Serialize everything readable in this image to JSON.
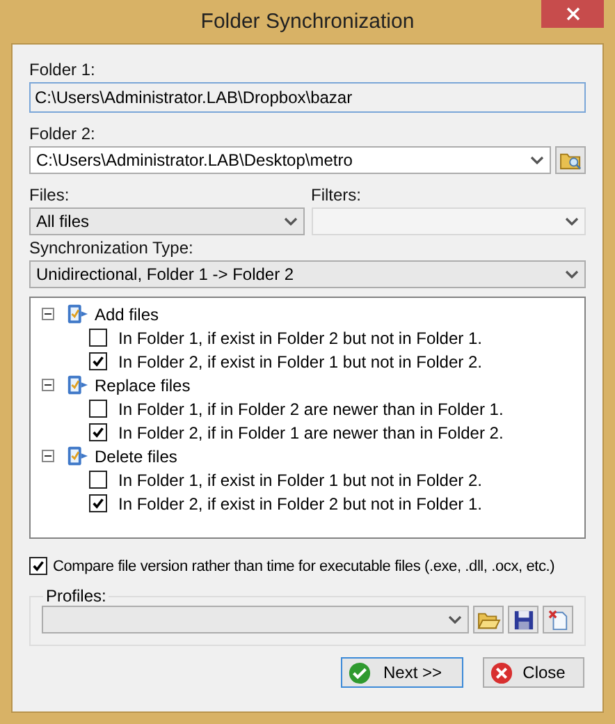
{
  "window": {
    "title": "Folder Synchronization"
  },
  "folder1": {
    "label": "Folder 1:",
    "value": "C:\\Users\\Administrator.LAB\\Dropbox\\bazar"
  },
  "folder2": {
    "label": "Folder 2:",
    "value": "C:\\Users\\Administrator.LAB\\Desktop\\metro"
  },
  "files": {
    "label": "Files:",
    "value": "All files"
  },
  "filters": {
    "label": "Filters:",
    "disabled": true
  },
  "sync_type": {
    "label": "Synchronization Type:",
    "value": "Unidirectional, Folder 1 -> Folder 2"
  },
  "tree": [
    {
      "label": "Add files",
      "expanded": true,
      "children": [
        {
          "label": "In Folder 1, if exist in Folder 2 but not in Folder 1.",
          "checked": false
        },
        {
          "label": "In Folder 2, if exist in Folder 1 but not in Folder 2.",
          "checked": true
        }
      ]
    },
    {
      "label": "Replace files",
      "expanded": true,
      "children": [
        {
          "label": "In Folder 1, if in Folder 2 are newer than in Folder 1.",
          "checked": false
        },
        {
          "label": "In Folder 2, if in Folder 1 are newer than in Folder 2.",
          "checked": true
        }
      ]
    },
    {
      "label": "Delete files",
      "expanded": true,
      "children": [
        {
          "label": "In Folder 1, if exist in Folder 1 but not in Folder 2.",
          "checked": false
        },
        {
          "label": "In Folder 2, if exist in Folder 2 but not in Folder 1.",
          "checked": true
        }
      ]
    }
  ],
  "compare_version": {
    "label": "Compare file version rather than time for executable files (.exe, .dll, .ocx, etc.)",
    "checked": true
  },
  "profiles": {
    "label": "Profiles:"
  },
  "buttons": [
    {
      "label": "Next >>",
      "kind": "next",
      "focused": true
    },
    {
      "label": "Close",
      "kind": "close",
      "focused": false
    }
  ]
}
